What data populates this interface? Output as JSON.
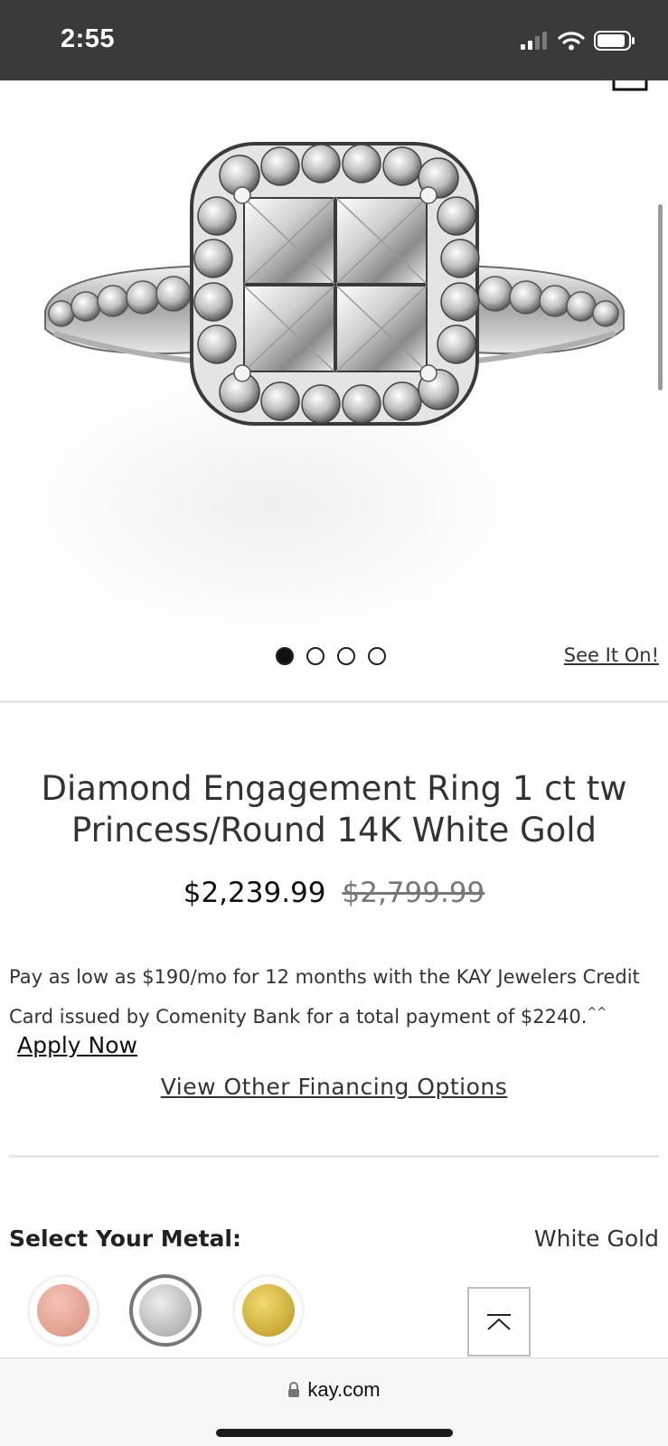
{
  "status_bar": {
    "time": "2:55",
    "icons": [
      "signal-icon",
      "wifi-icon",
      "battery-icon"
    ]
  },
  "gallery": {
    "image": "diamond-engagement-ring-image",
    "dots_total": 4,
    "active_dot": 1,
    "see_it_on": "See It On!"
  },
  "product": {
    "title_line1": "Diamond Engagement Ring 1 ct tw",
    "title_line2": "Princess/Round 14K White Gold",
    "price_now": "$2,239.99",
    "price_was": "$2,799.99"
  },
  "financing": {
    "text": "Pay as low as $190/mo for 12 months with the KAY Jewelers Credit Card issued by Comenity Bank for a total payment of $2240.",
    "footnote_mark": "^^",
    "apply_now": "Apply Now",
    "view_other": "View Other Financing Options"
  },
  "metal": {
    "label": "Select Your Metal:",
    "selected": "White Gold",
    "options": [
      {
        "name": "rose-gold",
        "color": "#e8a393"
      },
      {
        "name": "white-gold",
        "color": "#c2c2c2"
      },
      {
        "name": "yellow-gold",
        "color": "#d6b63a"
      }
    ]
  },
  "browser": {
    "url": "kay.com"
  },
  "colors": {
    "status_bar_bg": "#3a3a3a",
    "text": "#333333",
    "strike_price": "#777777"
  }
}
